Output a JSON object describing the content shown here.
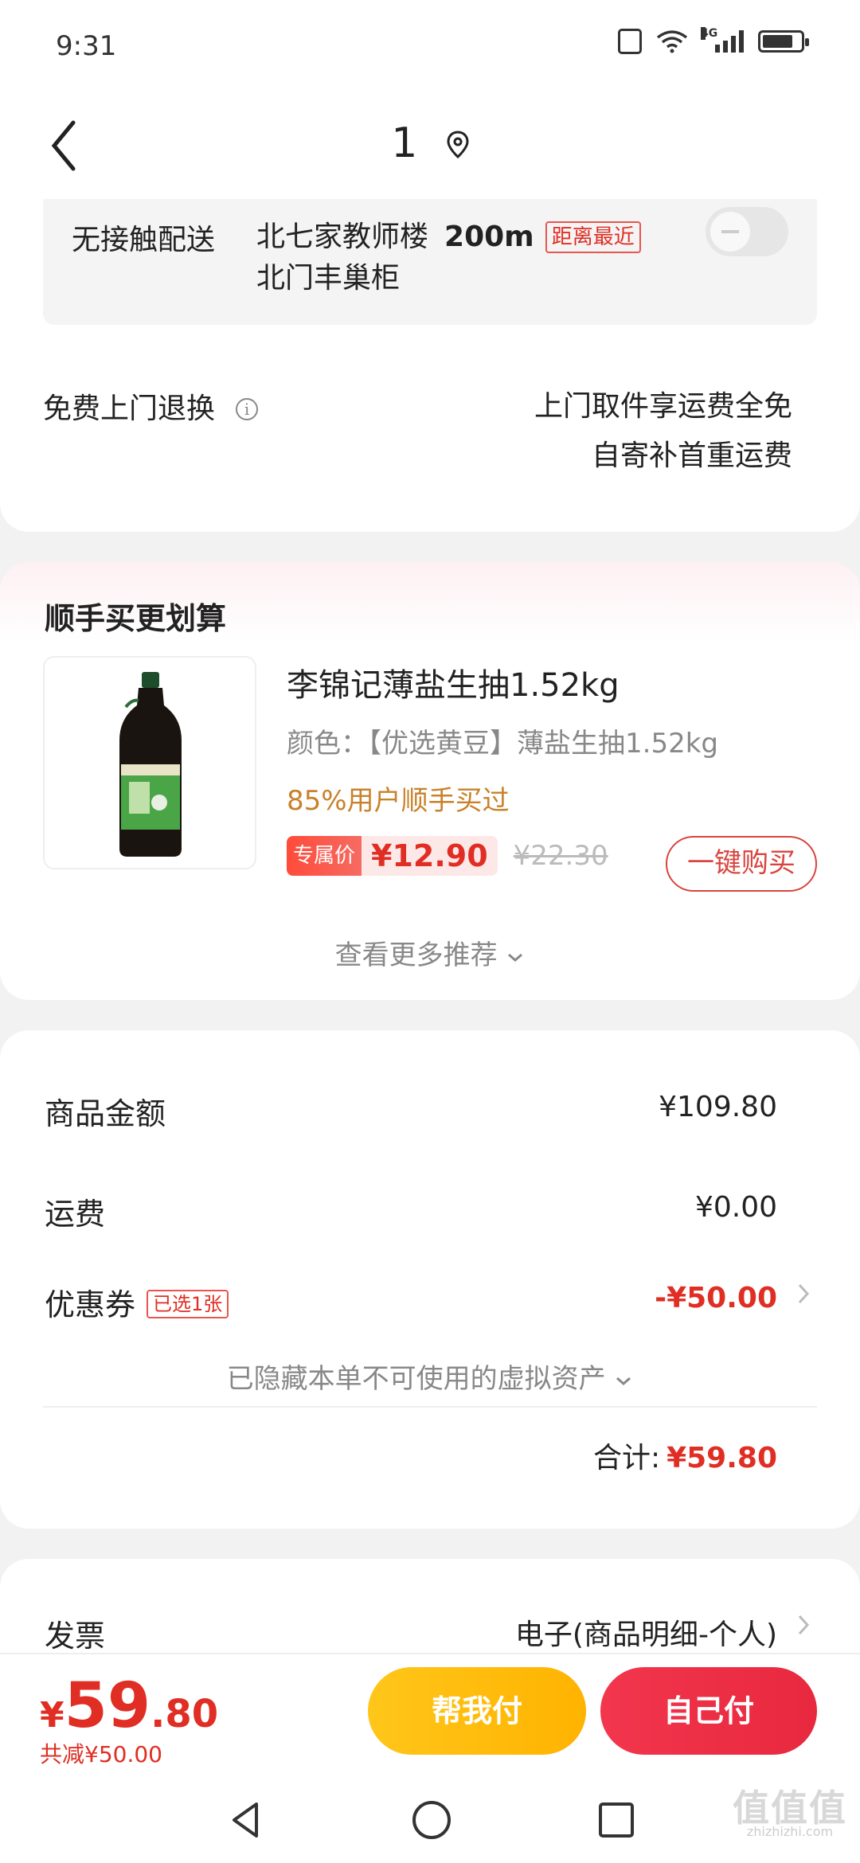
{
  "status_bar": {
    "time": "9:31",
    "network": "4G"
  },
  "header": {
    "title": "1"
  },
  "pickup": {
    "label": "无接触配送",
    "location_line1": "北七家教师楼",
    "distance": "200m",
    "nearest_tag": "距离最近",
    "location_line2": "北门丰巢柜"
  },
  "returns": {
    "label": "免费上门退换",
    "info_icon": "i",
    "line1": "上门取件享运费全免",
    "line2": "自寄补首重运费"
  },
  "recommend": {
    "title": "顺手买更划算",
    "product": {
      "name": "李锦记薄盐生抽1.52kg",
      "spec": "颜色：【优选黄豆】薄盐生抽1.52kg",
      "social_proof": "85%用户顺手买过",
      "exclusive_tag": "专属价",
      "price": "¥12.90",
      "original_price": "¥22.30",
      "buy_label": "一键购买"
    },
    "more_label": "查看更多推荐"
  },
  "summary": {
    "goods_label": "商品金额",
    "goods_value": "¥109.80",
    "shipping_label": "运费",
    "shipping_value": "¥0.00",
    "coupon_label": "优惠券",
    "coupon_tag": "已选1张",
    "coupon_value": "-¥50.00",
    "hidden_assets": "已隐藏本单不可使用的虚拟资产",
    "total_label": "合计:",
    "total_value": "¥59.80"
  },
  "invoice": {
    "label": "发票",
    "value": "电子(商品明细-个人)"
  },
  "bottom": {
    "currency": "¥",
    "amount_int": "59",
    "amount_dec": ".80",
    "saved": "共减¥50.00",
    "help_pay": "帮我付",
    "self_pay": "自己付"
  },
  "watermark": {
    "text": "值值值",
    "url": "zhizhizhi.com"
  },
  "colors": {
    "accent_red": "#e02e24",
    "help_yellow": "#ffb300",
    "social_orange": "#c9812a"
  }
}
